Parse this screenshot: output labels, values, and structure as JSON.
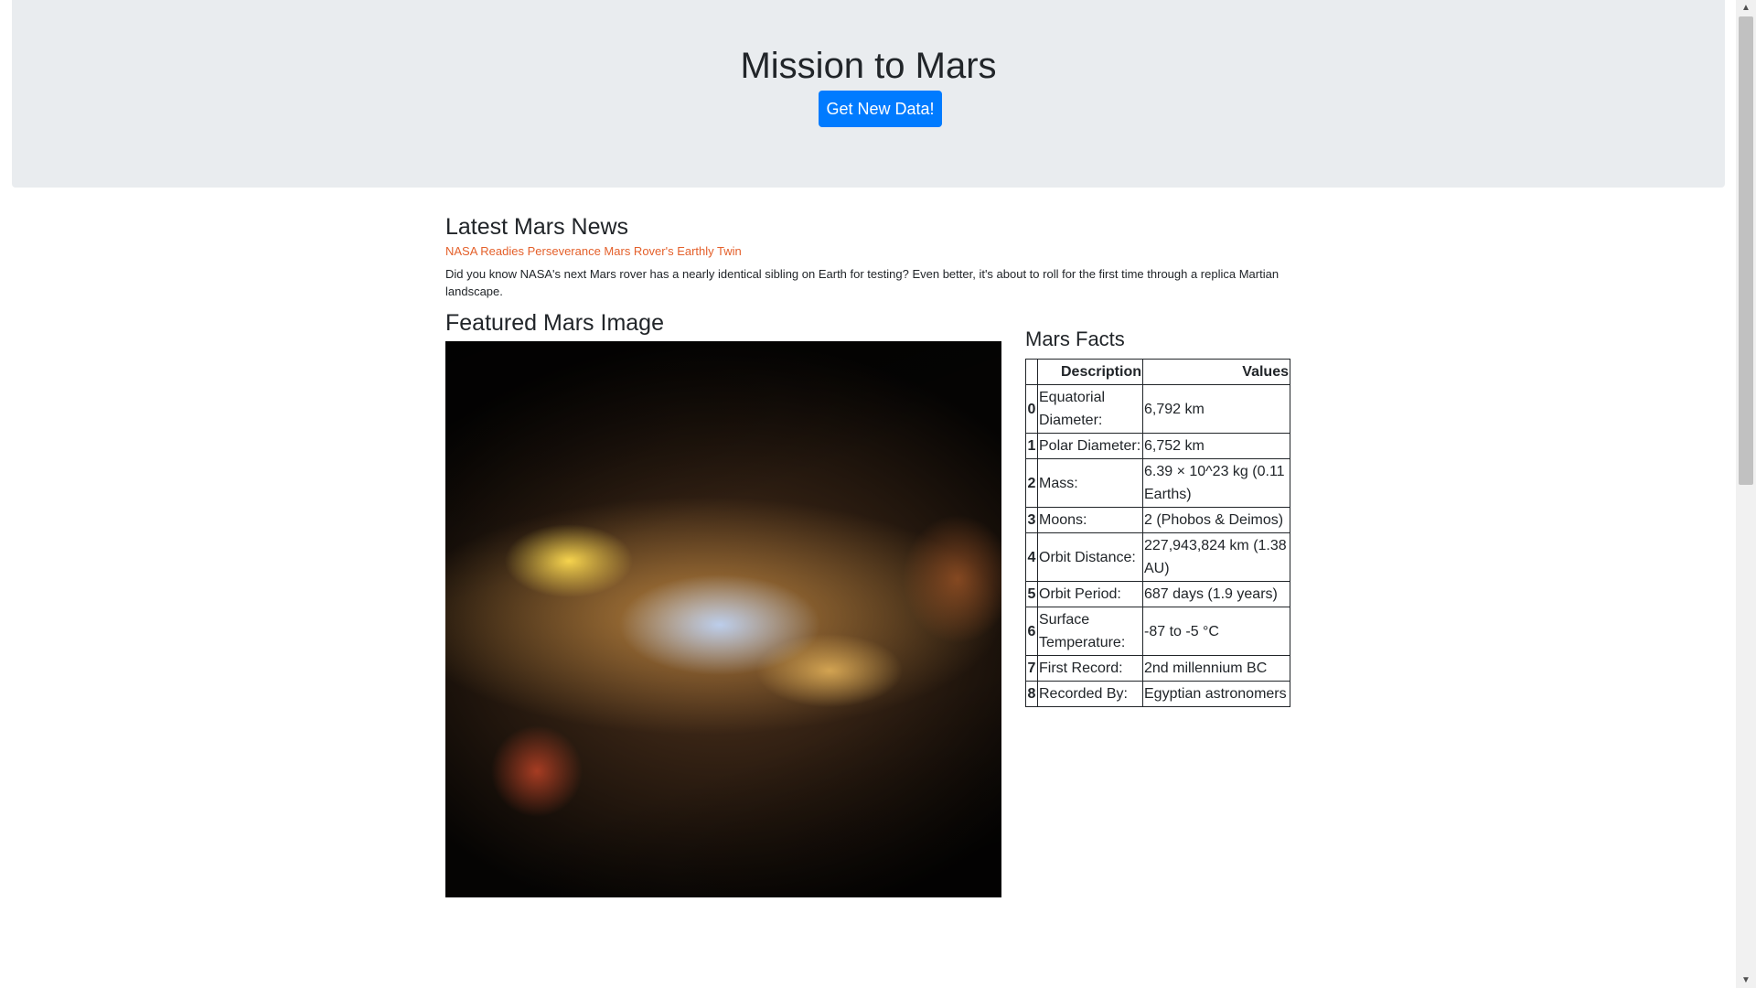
{
  "header": {
    "title": "Mission to Mars",
    "button_label": "Get New Data!"
  },
  "news": {
    "heading": "Latest Mars News",
    "title": "NASA Readies Perseverance Mars Rover's Earthly Twin",
    "paragraph": "Did you know NASA's next Mars rover has a nearly identical sibling on Earth for testing? Even better, it's about to roll for the first time through a replica Martian landscape."
  },
  "featured": {
    "heading": "Featured Mars Image"
  },
  "facts": {
    "heading": "Mars Facts",
    "columns": [
      "",
      "Description",
      "Values"
    ],
    "rows": [
      {
        "index": "0",
        "description": "Equatorial Diameter:",
        "value": "6,792 km"
      },
      {
        "index": "1",
        "description": "Polar Diameter:",
        "value": "6,752 km"
      },
      {
        "index": "2",
        "description": "Mass:",
        "value": "6.39 × 10^23 kg (0.11 Earths)"
      },
      {
        "index": "3",
        "description": "Moons:",
        "value": "2 (Phobos & Deimos)"
      },
      {
        "index": "4",
        "description": "Orbit Distance:",
        "value": "227,943,824 km (1.38 AU)"
      },
      {
        "index": "5",
        "description": "Orbit Period:",
        "value": "687 days (1.9 years)"
      },
      {
        "index": "6",
        "description": "Surface Temperature:",
        "value": "-87 to -5 °C"
      },
      {
        "index": "7",
        "description": "First Record:",
        "value": "2nd millennium BC"
      },
      {
        "index": "8",
        "description": "Recorded By:",
        "value": "Egyptian astronomers"
      }
    ]
  },
  "colors": {
    "jumbotron_bg": "#e9ecef",
    "button_bg": "#007bff",
    "news_title": "#e4602b"
  }
}
